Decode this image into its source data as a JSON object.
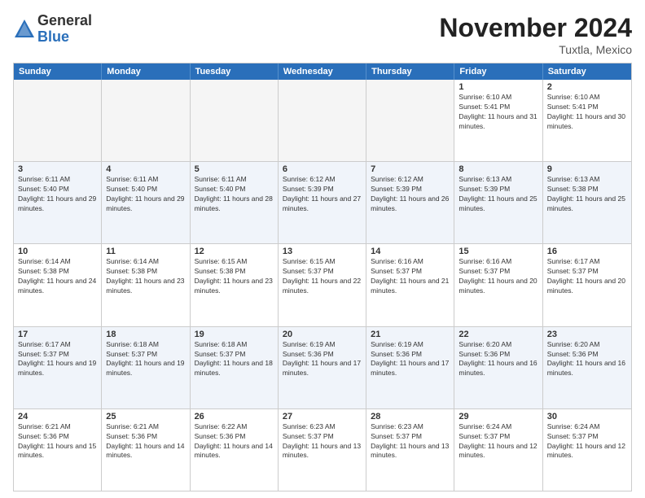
{
  "logo": {
    "general": "General",
    "blue": "Blue"
  },
  "header": {
    "month": "November 2024",
    "location": "Tuxtla, Mexico"
  },
  "days_of_week": [
    "Sunday",
    "Monday",
    "Tuesday",
    "Wednesday",
    "Thursday",
    "Friday",
    "Saturday"
  ],
  "rows": [
    [
      {
        "day": "",
        "empty": true
      },
      {
        "day": "",
        "empty": true
      },
      {
        "day": "",
        "empty": true
      },
      {
        "day": "",
        "empty": true
      },
      {
        "day": "",
        "empty": true
      },
      {
        "day": "1",
        "sunrise": "6:10 AM",
        "sunset": "5:41 PM",
        "daylight": "11 hours and 31 minutes."
      },
      {
        "day": "2",
        "sunrise": "6:10 AM",
        "sunset": "5:41 PM",
        "daylight": "11 hours and 30 minutes."
      }
    ],
    [
      {
        "day": "3",
        "sunrise": "6:11 AM",
        "sunset": "5:40 PM",
        "daylight": "11 hours and 29 minutes."
      },
      {
        "day": "4",
        "sunrise": "6:11 AM",
        "sunset": "5:40 PM",
        "daylight": "11 hours and 29 minutes."
      },
      {
        "day": "5",
        "sunrise": "6:11 AM",
        "sunset": "5:40 PM",
        "daylight": "11 hours and 28 minutes."
      },
      {
        "day": "6",
        "sunrise": "6:12 AM",
        "sunset": "5:39 PM",
        "daylight": "11 hours and 27 minutes."
      },
      {
        "day": "7",
        "sunrise": "6:12 AM",
        "sunset": "5:39 PM",
        "daylight": "11 hours and 26 minutes."
      },
      {
        "day": "8",
        "sunrise": "6:13 AM",
        "sunset": "5:39 PM",
        "daylight": "11 hours and 25 minutes."
      },
      {
        "day": "9",
        "sunrise": "6:13 AM",
        "sunset": "5:38 PM",
        "daylight": "11 hours and 25 minutes."
      }
    ],
    [
      {
        "day": "10",
        "sunrise": "6:14 AM",
        "sunset": "5:38 PM",
        "daylight": "11 hours and 24 minutes."
      },
      {
        "day": "11",
        "sunrise": "6:14 AM",
        "sunset": "5:38 PM",
        "daylight": "11 hours and 23 minutes."
      },
      {
        "day": "12",
        "sunrise": "6:15 AM",
        "sunset": "5:38 PM",
        "daylight": "11 hours and 23 minutes."
      },
      {
        "day": "13",
        "sunrise": "6:15 AM",
        "sunset": "5:37 PM",
        "daylight": "11 hours and 22 minutes."
      },
      {
        "day": "14",
        "sunrise": "6:16 AM",
        "sunset": "5:37 PM",
        "daylight": "11 hours and 21 minutes."
      },
      {
        "day": "15",
        "sunrise": "6:16 AM",
        "sunset": "5:37 PM",
        "daylight": "11 hours and 20 minutes."
      },
      {
        "day": "16",
        "sunrise": "6:17 AM",
        "sunset": "5:37 PM",
        "daylight": "11 hours and 20 minutes."
      }
    ],
    [
      {
        "day": "17",
        "sunrise": "6:17 AM",
        "sunset": "5:37 PM",
        "daylight": "11 hours and 19 minutes."
      },
      {
        "day": "18",
        "sunrise": "6:18 AM",
        "sunset": "5:37 PM",
        "daylight": "11 hours and 19 minutes."
      },
      {
        "day": "19",
        "sunrise": "6:18 AM",
        "sunset": "5:37 PM",
        "daylight": "11 hours and 18 minutes."
      },
      {
        "day": "20",
        "sunrise": "6:19 AM",
        "sunset": "5:36 PM",
        "daylight": "11 hours and 17 minutes."
      },
      {
        "day": "21",
        "sunrise": "6:19 AM",
        "sunset": "5:36 PM",
        "daylight": "11 hours and 17 minutes."
      },
      {
        "day": "22",
        "sunrise": "6:20 AM",
        "sunset": "5:36 PM",
        "daylight": "11 hours and 16 minutes."
      },
      {
        "day": "23",
        "sunrise": "6:20 AM",
        "sunset": "5:36 PM",
        "daylight": "11 hours and 16 minutes."
      }
    ],
    [
      {
        "day": "24",
        "sunrise": "6:21 AM",
        "sunset": "5:36 PM",
        "daylight": "11 hours and 15 minutes."
      },
      {
        "day": "25",
        "sunrise": "6:21 AM",
        "sunset": "5:36 PM",
        "daylight": "11 hours and 14 minutes."
      },
      {
        "day": "26",
        "sunrise": "6:22 AM",
        "sunset": "5:36 PM",
        "daylight": "11 hours and 14 minutes."
      },
      {
        "day": "27",
        "sunrise": "6:23 AM",
        "sunset": "5:37 PM",
        "daylight": "11 hours and 13 minutes."
      },
      {
        "day": "28",
        "sunrise": "6:23 AM",
        "sunset": "5:37 PM",
        "daylight": "11 hours and 13 minutes."
      },
      {
        "day": "29",
        "sunrise": "6:24 AM",
        "sunset": "5:37 PM",
        "daylight": "11 hours and 12 minutes."
      },
      {
        "day": "30",
        "sunrise": "6:24 AM",
        "sunset": "5:37 PM",
        "daylight": "11 hours and 12 minutes."
      }
    ]
  ]
}
